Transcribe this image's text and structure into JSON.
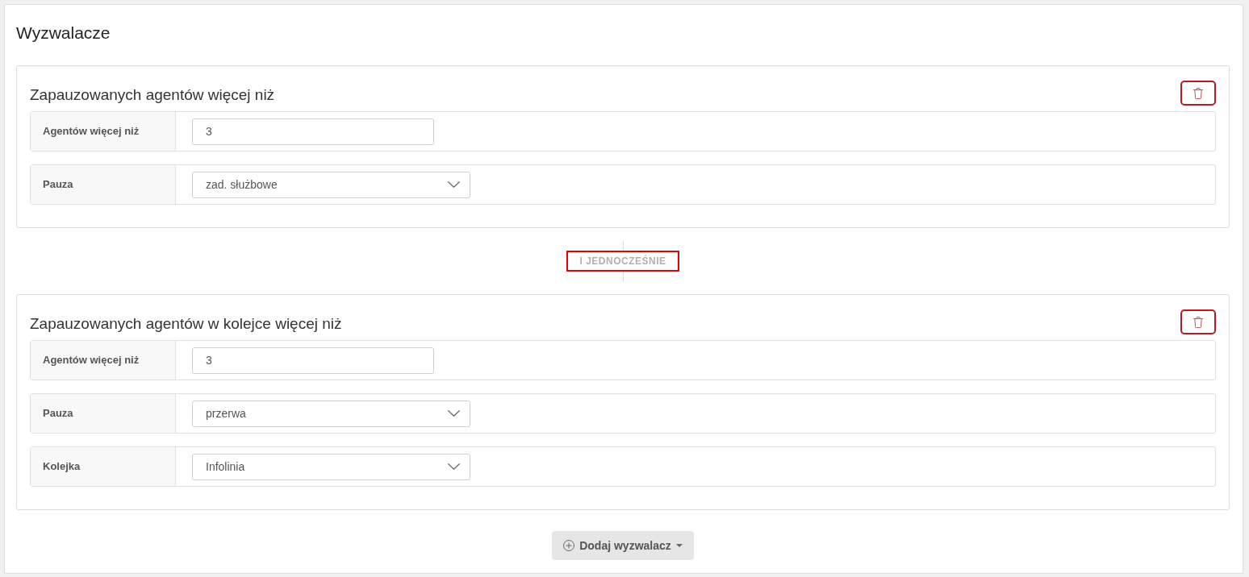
{
  "panel": {
    "title": "Wyzwalacze"
  },
  "triggers": [
    {
      "title": "Zapauzowanych agentów więcej niż",
      "fields": [
        {
          "kind": "input",
          "label": "Agentów więcej niż",
          "value": "3"
        },
        {
          "kind": "select",
          "label": "Pauza",
          "value": "zad. służbowe"
        }
      ]
    },
    {
      "title": "Zapauzowanych agentów w kolejce więcej niż",
      "fields": [
        {
          "kind": "input",
          "label": "Agentów więcej niż",
          "value": "3"
        },
        {
          "kind": "select",
          "label": "Pauza",
          "value": "przerwa"
        },
        {
          "kind": "select",
          "label": "Kolejka",
          "value": "Infolinia"
        }
      ]
    }
  ],
  "connector": {
    "label": "I JEDNOCZEŚNIE"
  },
  "add_button": {
    "label": "Dodaj wyzwalacz"
  }
}
